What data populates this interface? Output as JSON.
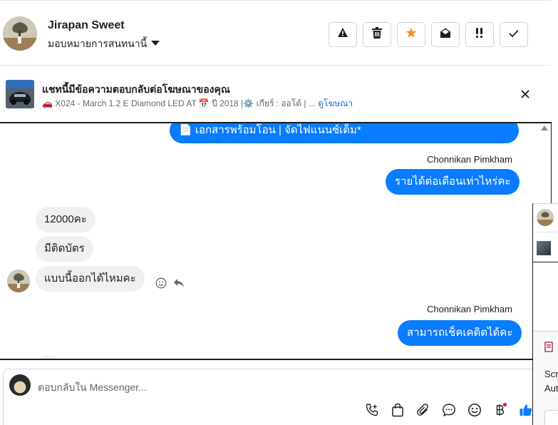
{
  "header": {
    "contact_name": "Jirapan Sweet",
    "assign_label": "มอบหมายการสนทนานี้",
    "toolbar": [
      {
        "name": "spam-button",
        "icon": "warning-icon"
      },
      {
        "name": "delete-button",
        "icon": "trash-icon"
      },
      {
        "name": "star-button",
        "icon": "star-icon"
      },
      {
        "name": "mark-unread-button",
        "icon": "envelope-open-icon"
      },
      {
        "name": "follow-up-button",
        "icon": "exclamation-icon"
      },
      {
        "name": "done-button",
        "icon": "check-icon"
      }
    ],
    "star_color": "#f7923a"
  },
  "ad": {
    "title": "แชทนี้มีข้อความตอบกลับต่อโฆษณาของคุณ",
    "subtitle": "🚗 X024 - March 1.2 E Diamond LED AT 📅 ปี 2018 |⚙️ เกียร์ : ออโต้ | ...",
    "link": "ดูโฆษณา"
  },
  "messages": {
    "m1": "📄 เอกสารพร้อมโอน | จัดไฟแนนซ์เต็ม*",
    "sender1": "Chonnikan Pimkham",
    "m2": "รายได้ต่อเดือนเท่าไหร่คะ",
    "m3": "12000คะ",
    "m4": "มีติดบัตร",
    "m5": "แบบนี้ออกได้ไหมคะ",
    "sender2": "Chonnikan Pimkham",
    "m6": "สามารถเช็คเคดิตได้คะ"
  },
  "composer": {
    "placeholder": "ตอบกลับใน Messenger...",
    "icons": [
      "add-call-icon",
      "shopping-bag-icon",
      "attachment-icon",
      "chat-bubble-icon",
      "emoji-icon",
      "baht-icon",
      "thumbs-up-icon"
    ],
    "accent": "#0a7cff"
  },
  "side": {
    "text1": "Scr",
    "text2": "Aut"
  }
}
